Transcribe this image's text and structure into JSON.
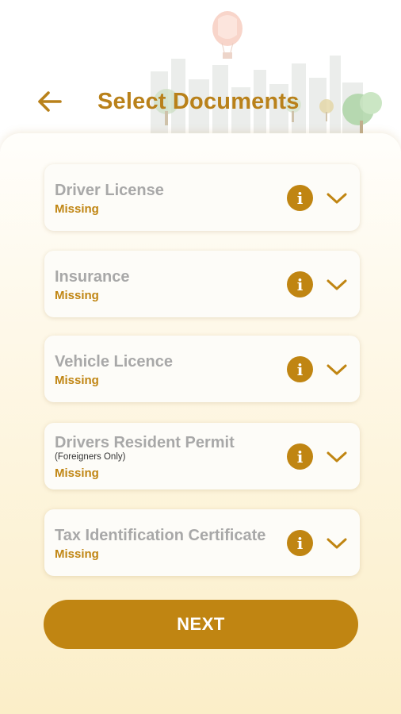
{
  "header": {
    "title": "Select Documents",
    "back_icon": "arrow-left-icon"
  },
  "documents": [
    {
      "name": "Driver License",
      "note": "",
      "status": "Missing"
    },
    {
      "name": "Insurance",
      "note": "",
      "status": "Missing"
    },
    {
      "name": "Vehicle Licence",
      "note": "",
      "status": "Missing"
    },
    {
      "name": "Drivers Resident Permit",
      "note": "(Foreigners Only)",
      "status": "Missing"
    },
    {
      "name": "Tax Identification Certificate",
      "note": "",
      "status": "Missing"
    }
  ],
  "info_glyph": "i",
  "next_label": "NEXT",
  "colors": {
    "accent": "#c08512",
    "title": "#b9811a",
    "doc_name": "#a8a8a8",
    "background_bottom": "#fbeec8"
  }
}
